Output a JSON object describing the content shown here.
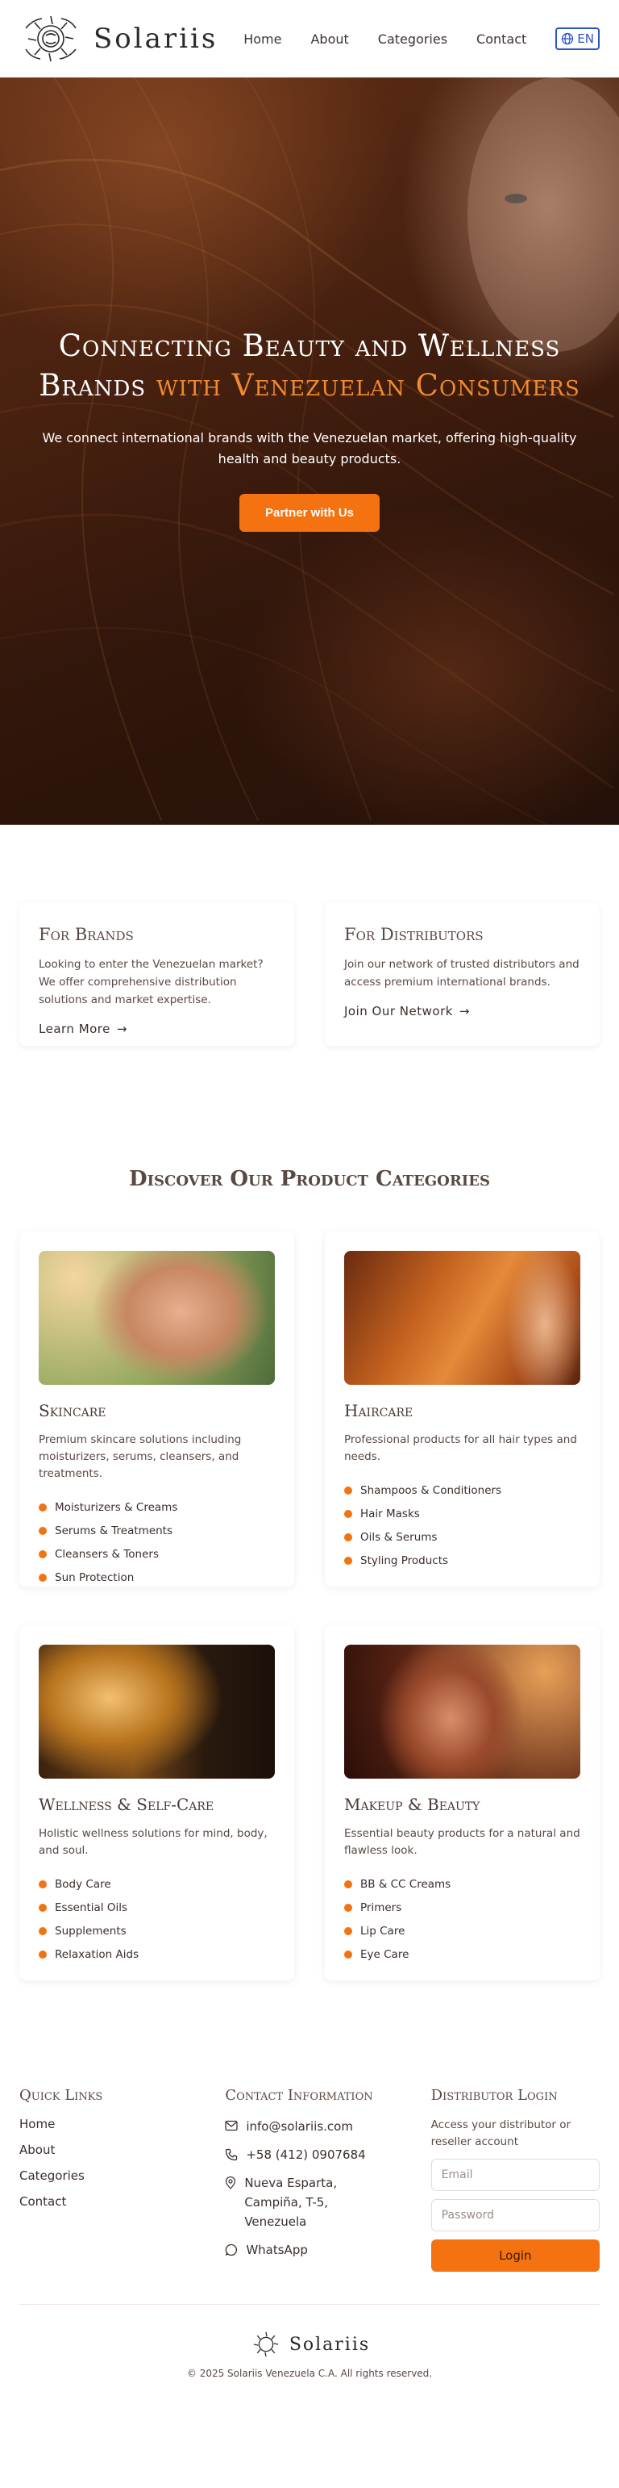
{
  "header": {
    "brand": "Solariis",
    "nav": [
      "Home",
      "About",
      "Categories",
      "Contact"
    ],
    "lang": "EN"
  },
  "hero": {
    "title_main": "Connecting Beauty and Wellness Brands",
    "title_accent": "with Venezuelan Consumers",
    "subtitle": "We connect international brands with the Venezuelan market, offering high-quality health and beauty products.",
    "cta": "Partner with Us"
  },
  "partners": [
    {
      "title": "For Brands",
      "text": "Looking to enter the Venezuelan market? We offer comprehensive distribution solutions and market expertise.",
      "link": "Learn More"
    },
    {
      "title": "For Distributors",
      "text": "Join our network of trusted distributors and access premium international brands.",
      "link": "Join Our Network"
    }
  ],
  "categories_title": "Discover Our Product Categories",
  "categories": [
    {
      "title": "Skincare",
      "text": "Premium skincare solutions including moisturizers, serums, cleansers, and treatments.",
      "items": [
        "Moisturizers & Creams",
        "Serums & Treatments",
        "Cleansers & Toners",
        "Sun Protection"
      ]
    },
    {
      "title": "Haircare",
      "text": "Professional products for all hair types and needs.",
      "items": [
        "Shampoos & Conditioners",
        "Hair Masks",
        "Oils & Serums",
        "Styling Products"
      ]
    },
    {
      "title": "Wellness & Self-Care",
      "text": "Holistic wellness solutions for mind, body, and soul.",
      "items": [
        "Body Care",
        "Essential Oils",
        "Supplements",
        "Relaxation Aids"
      ]
    },
    {
      "title": "Makeup & Beauty",
      "text": "Essential beauty products for a natural and flawless look.",
      "items": [
        "BB & CC Creams",
        "Primers",
        "Lip Care",
        "Eye Care"
      ]
    }
  ],
  "footer": {
    "quick_links_title": "Quick Links",
    "quick_links": [
      "Home",
      "About",
      "Categories",
      "Contact"
    ],
    "contact_title": "Contact Information",
    "email": "info@solariis.com",
    "phone": "+58 (412) 0907684",
    "address": "Nueva Esparta, Campiña, T-5, Venezuela",
    "whatsapp": "WhatsApp",
    "login_title": "Distributor Login",
    "login_note": "Access your distributor or reseller account",
    "email_placeholder": "Email",
    "password_placeholder": "Password",
    "login_button": "Login",
    "brand": "Solariis",
    "copyright": "© 2025 Solariis Venezuela C.A. All rights reserved."
  },
  "colors": {
    "accent": "#f4720f",
    "text": "#3a2e2a",
    "lang_border": "#2f55c7"
  }
}
